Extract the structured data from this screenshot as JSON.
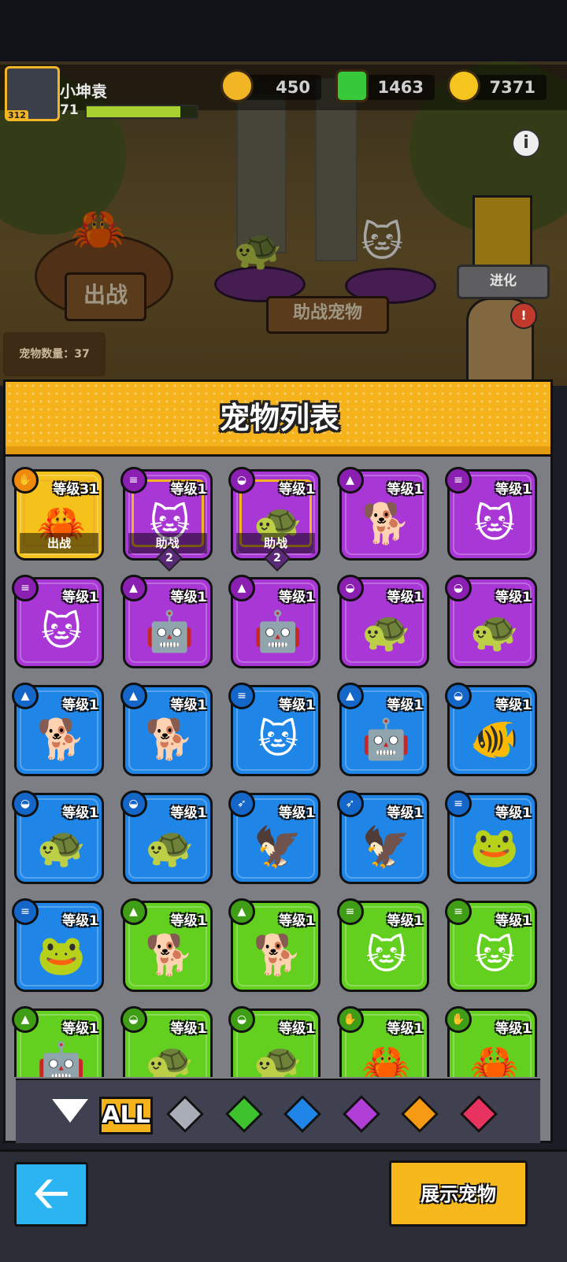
{
  "header": {
    "player_name": "小坤袁",
    "player_level": "71",
    "avatar_badge": "312",
    "xp_progress": 0.85,
    "currencies": [
      {
        "name": "coin",
        "value": "450",
        "color": "#f2b523"
      },
      {
        "name": "green-gem",
        "value": "1463",
        "color": "#38c93a"
      },
      {
        "name": "gold-plus",
        "value": "7371",
        "color": "#f5c51d"
      }
    ],
    "info_label": "i"
  },
  "scene": {
    "deploy_sign": "出战",
    "assist_sign": "助战宠物",
    "evolve_label": "进化",
    "pet_count": "宠物数量：37",
    "alert": "!"
  },
  "panel": {
    "title": "宠物列表"
  },
  "pets": [
    {
      "level": "等级31",
      "rarity": "gold",
      "type_icon": "paw-icon",
      "sprite": "🦀",
      "status": "出战"
    },
    {
      "level": "等级1",
      "rarity": "purple",
      "type_icon": "coins-icon",
      "sprite": "🐱",
      "status": "助战",
      "badge": "2"
    },
    {
      "level": "等级1",
      "rarity": "purple",
      "type_icon": "shell-icon",
      "sprite": "🐢",
      "status": "助战",
      "badge": "2"
    },
    {
      "level": "等级1",
      "rarity": "purple",
      "type_icon": "dog-icon",
      "sprite": "🐕"
    },
    {
      "level": "等级1",
      "rarity": "purple",
      "type_icon": "coins-icon",
      "sprite": "🐱"
    },
    {
      "level": "等级1",
      "rarity": "purple",
      "type_icon": "coins-icon",
      "sprite": "🐱"
    },
    {
      "level": "等级1",
      "rarity": "purple",
      "type_icon": "dog-icon",
      "sprite": "🤖"
    },
    {
      "level": "等级1",
      "rarity": "purple",
      "type_icon": "dog-icon",
      "sprite": "🤖"
    },
    {
      "level": "等级1",
      "rarity": "purple",
      "type_icon": "shell-icon",
      "sprite": "🐢"
    },
    {
      "level": "等级1",
      "rarity": "purple",
      "type_icon": "shell-icon",
      "sprite": "🐢"
    },
    {
      "level": "等级1",
      "rarity": "blue",
      "type_icon": "dog-icon",
      "sprite": "🐕"
    },
    {
      "level": "等级1",
      "rarity": "blue",
      "type_icon": "dog-icon",
      "sprite": "🐕"
    },
    {
      "level": "等级1",
      "rarity": "blue",
      "type_icon": "coins-icon",
      "sprite": "🐱"
    },
    {
      "level": "等级1",
      "rarity": "blue",
      "type_icon": "dog-icon",
      "sprite": "🤖"
    },
    {
      "level": "等级1",
      "rarity": "blue",
      "type_icon": "shell-icon",
      "sprite": "🐠"
    },
    {
      "level": "等级1",
      "rarity": "blue",
      "type_icon": "shell-icon",
      "sprite": "🐢"
    },
    {
      "level": "等级1",
      "rarity": "blue",
      "type_icon": "shell-icon",
      "sprite": "🐢"
    },
    {
      "level": "等级1",
      "rarity": "blue",
      "type_icon": "eagle-icon",
      "sprite": "🦅"
    },
    {
      "level": "等级1",
      "rarity": "blue",
      "type_icon": "eagle-icon",
      "sprite": "🦅"
    },
    {
      "level": "等级1",
      "rarity": "blue",
      "type_icon": "coins-icon",
      "sprite": "🐸"
    },
    {
      "level": "等级1",
      "rarity": "blue",
      "type_icon": "coins-icon",
      "sprite": "🐸"
    },
    {
      "level": "等级1",
      "rarity": "green",
      "type_icon": "dog-icon",
      "sprite": "🐕"
    },
    {
      "level": "等级1",
      "rarity": "green",
      "type_icon": "dog-icon",
      "sprite": "🐕"
    },
    {
      "level": "等级1",
      "rarity": "green",
      "type_icon": "coins-icon",
      "sprite": "🐱"
    },
    {
      "level": "等级1",
      "rarity": "green",
      "type_icon": "coins-icon",
      "sprite": "🐱"
    },
    {
      "level": "等级1",
      "rarity": "green",
      "type_icon": "dog-icon",
      "sprite": "🤖"
    },
    {
      "level": "等级1",
      "rarity": "green",
      "type_icon": "shell-icon",
      "sprite": "🐢"
    },
    {
      "level": "等级1",
      "rarity": "green",
      "type_icon": "shell-icon",
      "sprite": "🐢"
    },
    {
      "level": "等级1",
      "rarity": "green",
      "type_icon": "paw-icon",
      "sprite": "🦀"
    },
    {
      "level": "等级1",
      "rarity": "green",
      "type_icon": "paw-icon",
      "sprite": "🦀"
    }
  ],
  "filters": {
    "collapse_icon": "triangle-down-icon",
    "all_label": "ALL",
    "gems": [
      {
        "name": "gray",
        "color": "#a9adb8"
      },
      {
        "name": "green",
        "color": "#3ec22e"
      },
      {
        "name": "blue",
        "color": "#1f86e8"
      },
      {
        "name": "purple",
        "color": "#b23ed8"
      },
      {
        "name": "orange",
        "color": "#f59a12"
      },
      {
        "name": "red",
        "color": "#e8325f"
      }
    ]
  },
  "footer": {
    "back_icon": "arrow-left-icon",
    "show_pets_label": "展示宠物"
  }
}
